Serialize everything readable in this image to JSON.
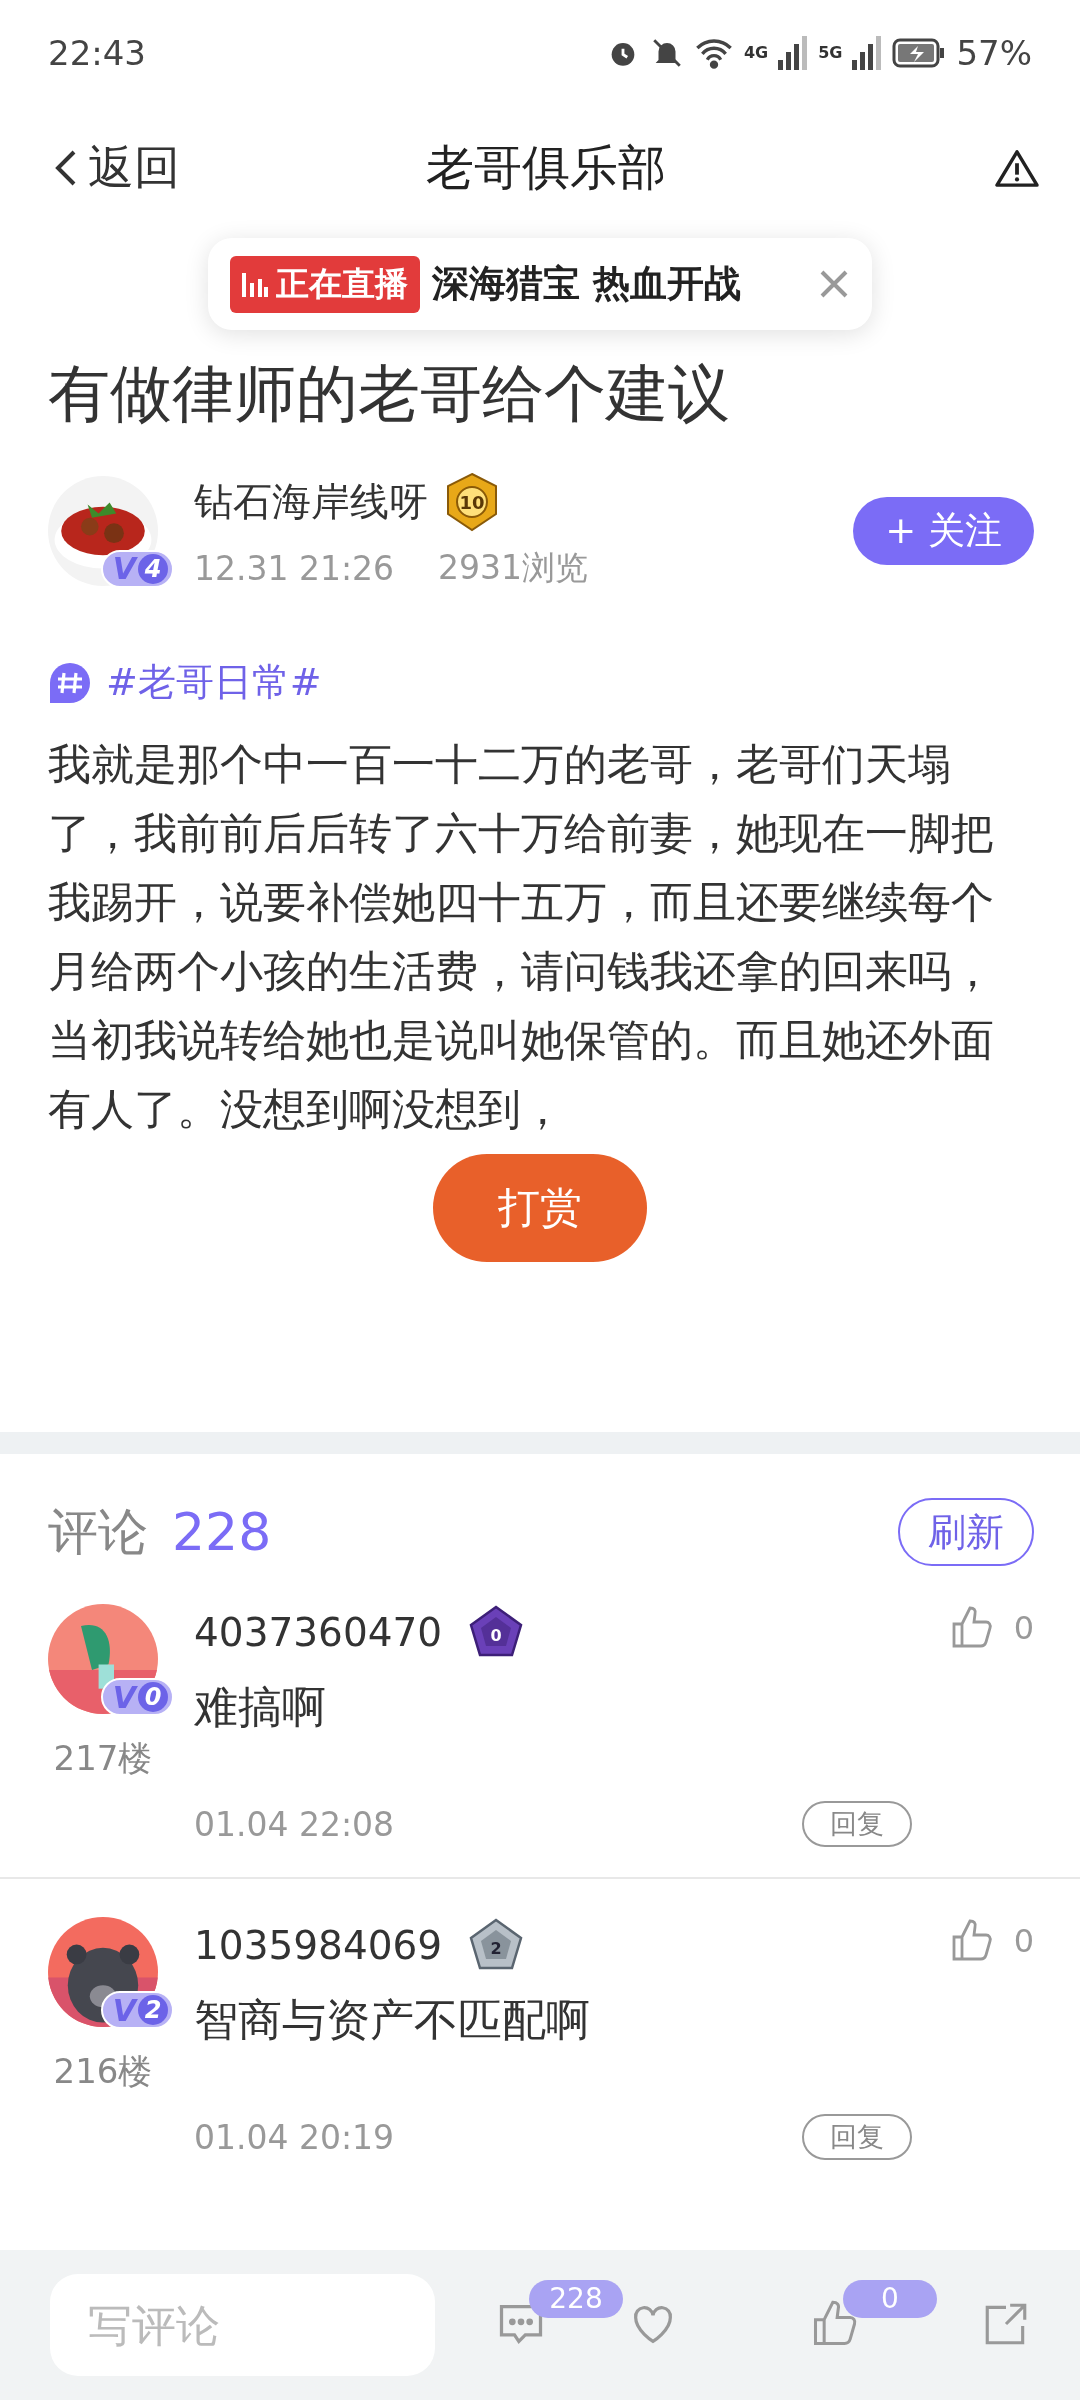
{
  "status_bar": {
    "time": "22:43",
    "net1": "4G",
    "net2": "5G",
    "battery": "57%"
  },
  "header": {
    "back": "返回",
    "title": "老哥俱乐部"
  },
  "live_banner": {
    "tag": "正在直播",
    "text": "深海猎宝 热血开战"
  },
  "post": {
    "title": "有做律师的老哥给个建议",
    "author": {
      "name": "钻石海岸线呀",
      "level": "10",
      "vip": "V",
      "vip_level": "4",
      "date": "12.31 21:26",
      "views": "2931浏览"
    },
    "follow": "+ 关注",
    "topic": "#老哥日常#",
    "body": "我就是那个中一百一十二万的老哥，老哥们天塌了，我前前后后转了六十万给前妻，她现在一脚把我踢开，说要补偿她四十五万，而且还要继续每个月给两个小孩的生活费，请问钱我还拿的回来吗，当初我说转给她也是说叫她保管的。而且她还外面有人了。没想到啊没想到，",
    "reward": "打赏"
  },
  "comments": {
    "label": "评论",
    "count": "228",
    "refresh": "刷新",
    "items": [
      {
        "name": "4037360470",
        "level": "0",
        "vip": "V",
        "vip_level": "0",
        "floor": "217楼",
        "text": "难搞啊",
        "time": "01.04 22:08",
        "likes": "0",
        "reply": "回复",
        "kind": "picture"
      },
      {
        "name": "1035984069",
        "level": "2",
        "vip": "V",
        "vip_level": "2",
        "floor": "216楼",
        "text": "智商与资产不匹配啊",
        "time": "01.04 20:19",
        "likes": "0",
        "reply": "回复",
        "kind": "picture"
      }
    ]
  },
  "bottom_bar": {
    "placeholder": "写评论",
    "comment_count": "228",
    "like_count": "0"
  }
}
